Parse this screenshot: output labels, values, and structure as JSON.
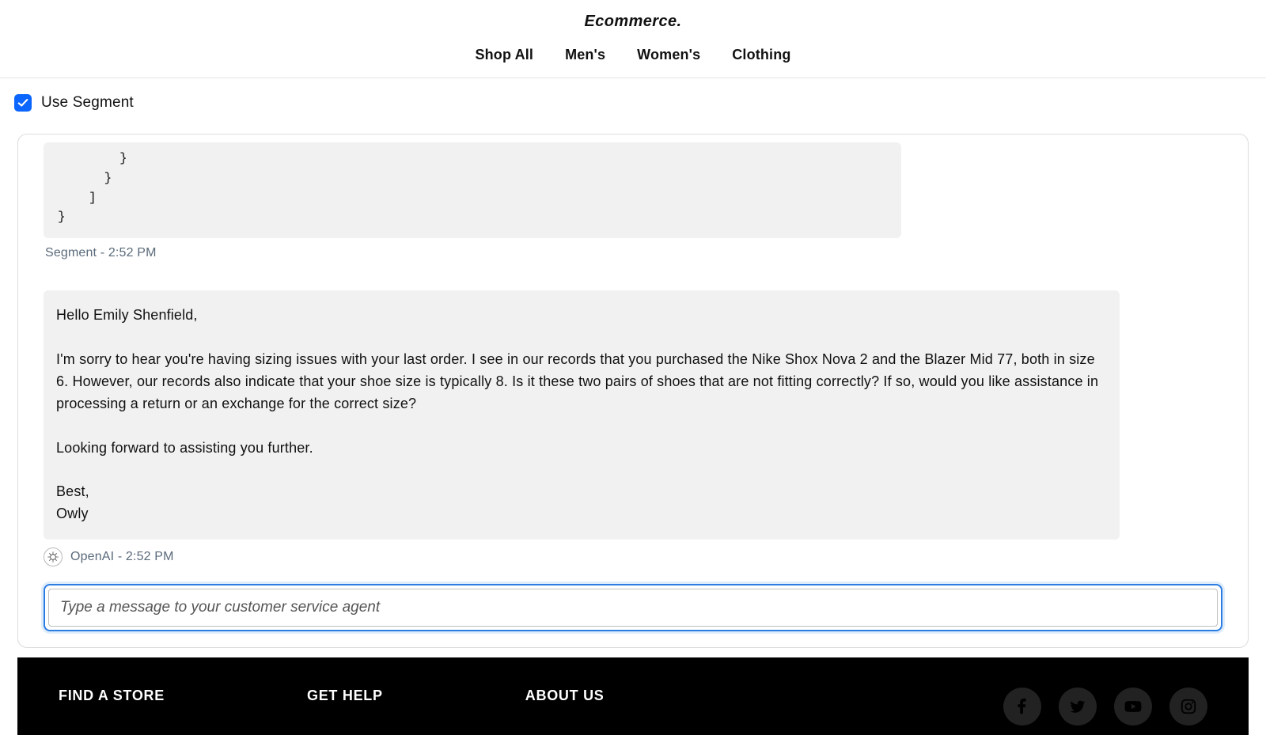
{
  "header": {
    "logo": "Ecommerce.",
    "nav": [
      "Shop All",
      "Men's",
      "Women's",
      "Clothing"
    ]
  },
  "segment": {
    "checkbox_label": "Use Segment",
    "checked": true
  },
  "chat": {
    "code_snippet": "        }\n      }\n    ]\n}",
    "segment_meta": "Segment - 2:52 PM",
    "assistant_message": "Hello Emily Shenfield,\n\nI'm sorry to hear you're having sizing issues with your last order. I see in our records that you purchased the Nike Shox Nova 2 and the Blazer Mid 77, both in size 6. However, our records also indicate that your shoe size is typically 8. Is it these two pairs of shoes that are not fitting correctly? If so, would you like assistance in processing a return or an exchange for the correct size?\n\nLooking forward to assisting you further.\n\nBest,\nOwly",
    "assistant_meta": "OpenAI - 2:52 PM",
    "input_placeholder": "Type a message to your customer service agent"
  },
  "footer": {
    "cols": [
      "FIND A STORE",
      "GET HELP",
      "ABOUT US"
    ],
    "social": [
      "facebook-icon",
      "twitter-icon",
      "youtube-icon",
      "instagram-icon"
    ]
  }
}
